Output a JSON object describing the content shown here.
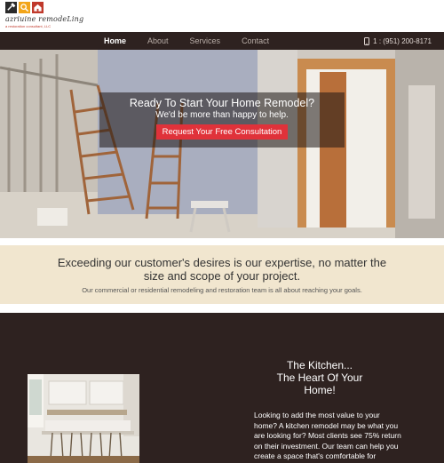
{
  "brand": {
    "name": "azriuine remodeLing",
    "tagline": "a restoration consultant, LLC"
  },
  "nav": {
    "items": [
      {
        "label": "Home",
        "active": true
      },
      {
        "label": "About",
        "active": false
      },
      {
        "label": "Services",
        "active": false
      },
      {
        "label": "Contact",
        "active": false
      }
    ],
    "phone": "1 : (951) 200-8171",
    "phone_icon": "phone-icon"
  },
  "hero": {
    "title": "Ready To Start Your Home Remodel?",
    "subtitle": "We'd be more than happy to help.",
    "cta_label": "Request Your Free Consultation",
    "cta_color": "#e0323a"
  },
  "band": {
    "heading_line1": "Exceeding our customer's desires is our expertise, no matter the",
    "heading_line2": "size and scope of your project.",
    "subtext": "Our commercial or residential remodeling and restoration team is all about reaching your goals.",
    "background": "#f1e6cf"
  },
  "kitchen": {
    "title_line1": "The Kitchen...",
    "title_line2": "The Heart Of Your",
    "title_line3": "Home!",
    "body": "Looking to add the most value to your home? A kitchen remodel may be what you are looking for? Most clients see 75% return on their investment. Our team can help you create a space that's comfortable for",
    "background": "#2e2220"
  }
}
